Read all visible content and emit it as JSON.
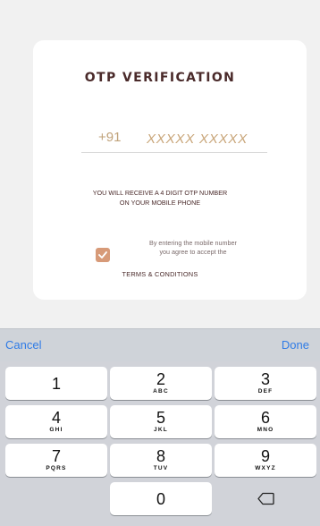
{
  "card": {
    "title": "OTP VERIFICATION",
    "country_code": "+91",
    "phone_placeholder": "XXXXX XXXXX",
    "info_line1": "YOU WILL RECEIVE A 4 DIGIT OTP NUMBER",
    "info_line2": "ON YOUR MOBILE PHONE",
    "consent_line1": "By entering the mobile number",
    "consent_line2": "you agree to accept the",
    "consent_checked": true,
    "terms_label": "TERMS & CONDITIONS"
  },
  "toolbar": {
    "cancel_label": "Cancel",
    "done_label": "Done"
  },
  "keypad": {
    "k1": {
      "num": "1",
      "sub": ""
    },
    "k2": {
      "num": "2",
      "sub": "ABC"
    },
    "k3": {
      "num": "3",
      "sub": "DEF"
    },
    "k4": {
      "num": "4",
      "sub": "GHI"
    },
    "k5": {
      "num": "5",
      "sub": "JKL"
    },
    "k6": {
      "num": "6",
      "sub": "MNO"
    },
    "k7": {
      "num": "7",
      "sub": "PQRS"
    },
    "k8": {
      "num": "8",
      "sub": "TUV"
    },
    "k9": {
      "num": "9",
      "sub": "WXYZ"
    },
    "k0": {
      "num": "0",
      "sub": ""
    },
    "backspace_icon": "backspace-icon"
  },
  "colors": {
    "accent": "#c9a67a",
    "checkbox": "#d79a78",
    "toolbar_link": "#2f7be6",
    "title_text": "#4a2a2a"
  }
}
